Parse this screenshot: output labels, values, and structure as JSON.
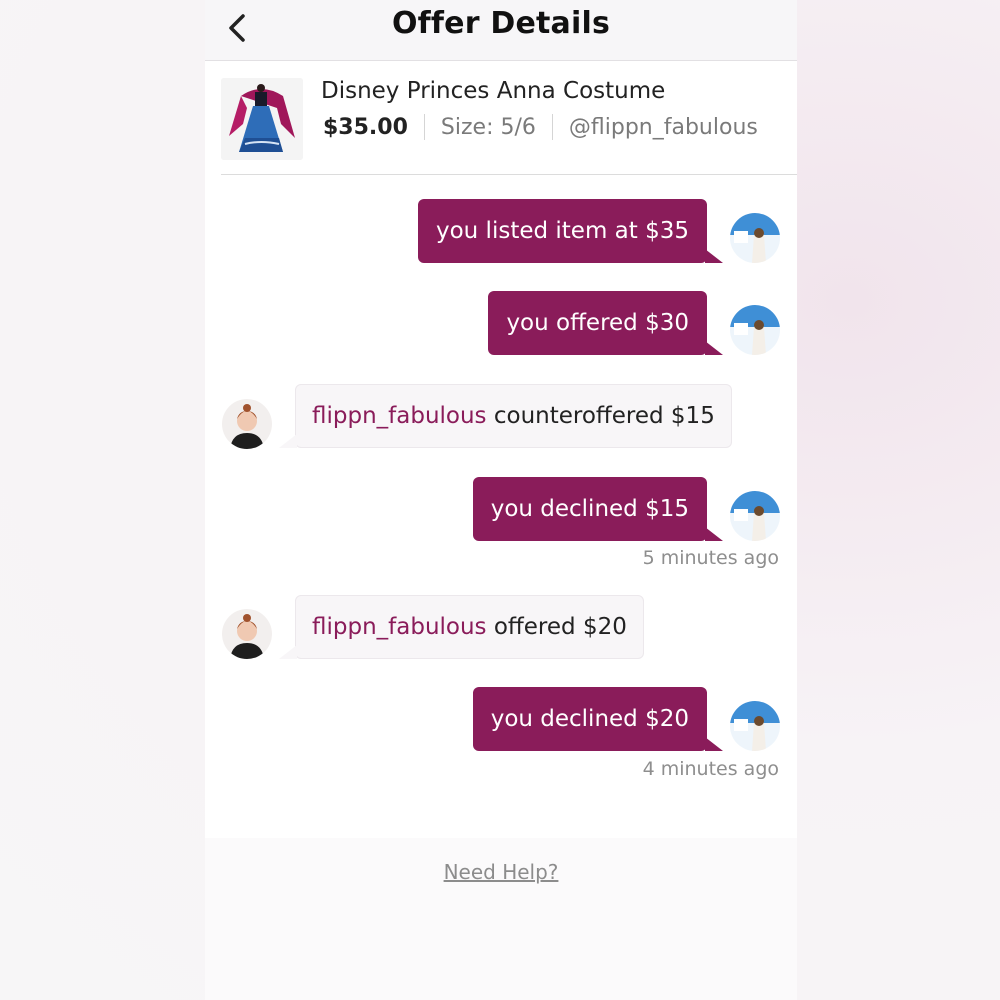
{
  "header": {
    "title": "Offer Details",
    "back_icon": "chevron-left-icon"
  },
  "item": {
    "title": "Disney Princes Anna Costume",
    "price": "$35.00",
    "size": "Size: 5/6",
    "seller": "@flippn_fabulous"
  },
  "messages": [
    {
      "direction": "out",
      "text": "you listed item at $35"
    },
    {
      "direction": "out",
      "text": "you offered $30"
    },
    {
      "direction": "in",
      "user": "flippn_fabulous",
      "text": " counteroffered $15"
    },
    {
      "direction": "out",
      "text": "you declined $15",
      "time": "5 minutes ago"
    },
    {
      "direction": "in",
      "user": "flippn_fabulous",
      "text": " offered $20"
    },
    {
      "direction": "out",
      "text": "you declined $20",
      "time": "4 minutes ago"
    }
  ],
  "footer": {
    "help": "Need Help?"
  },
  "colors": {
    "accent": "#8a1c5a",
    "bubble_in": "#f8f6f8",
    "header_bg": "#f7f6f8"
  }
}
